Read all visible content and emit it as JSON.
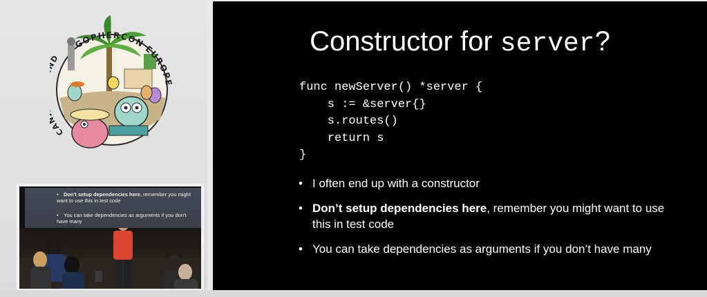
{
  "logo": {
    "ring_top_text": "GOPHERCON EUROPE",
    "ring_left_text": "CANARY ISLANDS"
  },
  "camera": {
    "slide_bullets": [
      {
        "bold": "Don't setup dependencies here",
        "rest": ", remember you might want to use this in test code"
      },
      {
        "bold": "",
        "rest": "You can take dependencies as arguments if you don't have many"
      }
    ]
  },
  "slide": {
    "title_text": "Constructor for ",
    "title_code": "server",
    "title_mark": "?",
    "code_lines": [
      "func newServer() *server {",
      "    s := &server{}",
      "    s.routes()",
      "    return s",
      "}"
    ],
    "bullets": [
      {
        "bold": "",
        "rest": "I often end up with a constructor"
      },
      {
        "bold": "Don’t setup dependencies here",
        "rest": ", remember you might want to use this in test code"
      },
      {
        "bold": "",
        "rest": "You can take dependencies as arguments if you don’t have many"
      }
    ]
  },
  "colors": {
    "slide_bg": "#000000",
    "slide_text": "#ffffff",
    "panel_bg": "#e6e6e6",
    "speaker_shirt": "#d9452e"
  }
}
